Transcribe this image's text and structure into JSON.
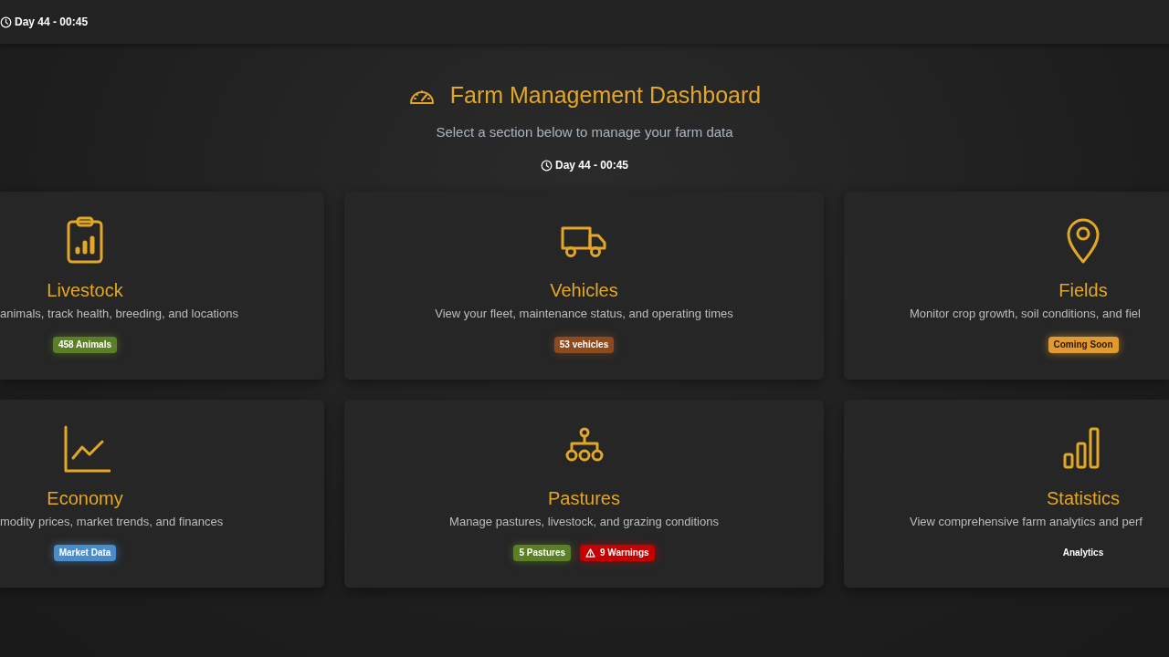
{
  "top_bar": {
    "time": "Day 44 - 00:45"
  },
  "header": {
    "title": "Farm Management Dashboard",
    "subtitle": "Select a section below to manage your farm data",
    "time": "Day 44 - 00:45"
  },
  "cards": [
    {
      "title": "Livestock",
      "description": "animals, track health, breeding, and locations",
      "badges": [
        {
          "kind": "count",
          "text": "458 Animals",
          "color": "#5b7f26"
        }
      ]
    },
    {
      "title": "Vehicles",
      "description": "View your fleet, maintenance status, and operating times",
      "badges": [
        {
          "kind": "count",
          "text": "53 vehicles",
          "color": "#8b4a1f"
        }
      ]
    },
    {
      "title": "Fields",
      "description": "Monitor crop growth, soil conditions, and fiel",
      "badges": [
        {
          "kind": "soon",
          "text": "Coming Soon",
          "color": "#e09a32"
        }
      ]
    },
    {
      "title": "Economy",
      "description": "modity prices, market trends, and finances",
      "badges": [
        {
          "kind": "count",
          "text": "Market Data",
          "color": "#4a8bc9"
        }
      ]
    },
    {
      "title": "Pastures",
      "description": "Manage pastures, livestock, and grazing conditions",
      "badges": [
        {
          "kind": "count",
          "text": "5 Pastures",
          "color": "#5b7f26"
        },
        {
          "kind": "warning",
          "text": "9 Warnings",
          "color": "#c40000"
        }
      ]
    },
    {
      "title": "Statistics",
      "description": "View comprehensive farm analytics and perf",
      "badges": [
        {
          "kind": "plain",
          "text": "Analytics"
        }
      ]
    }
  ]
}
